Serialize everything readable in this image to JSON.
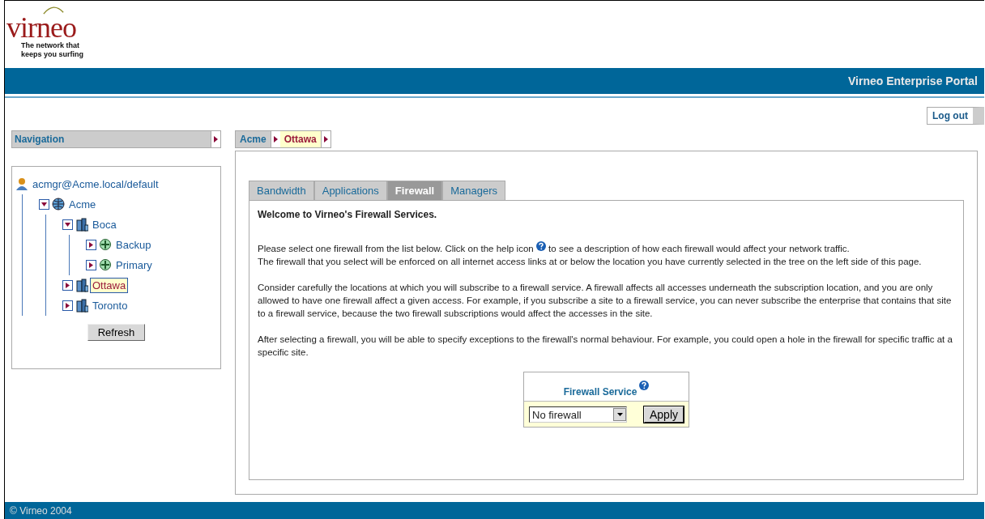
{
  "logo": {
    "wordmark": "virneo",
    "tagline": "The network that keeps you surfing"
  },
  "header_bar": {
    "title": "Virneo Enterprise Portal"
  },
  "logout_button": "Log out",
  "navigation": {
    "title": "Navigation",
    "tree": [
      {
        "label": "acmgr@Acme.local/default",
        "kind": "user",
        "selected": false,
        "children": [
          {
            "label": "Acme",
            "kind": "enterprise",
            "expanded": true,
            "selected": false,
            "children": [
              {
                "label": "Boca",
                "kind": "site",
                "expanded": true,
                "selected": false,
                "children": [
                  {
                    "label": "Backup",
                    "kind": "access",
                    "expanded": false,
                    "selected": false
                  },
                  {
                    "label": "Primary",
                    "kind": "access",
                    "expanded": false,
                    "selected": false
                  }
                ]
              },
              {
                "label": "Ottawa",
                "kind": "site",
                "expanded": false,
                "selected": true
              },
              {
                "label": "Toronto",
                "kind": "site",
                "expanded": false,
                "selected": false
              }
            ]
          }
        ]
      }
    ],
    "refresh_button": "Refresh"
  },
  "breadcrumb": [
    {
      "label": "Acme",
      "selected": false
    },
    {
      "label": "Ottawa",
      "selected": true
    }
  ],
  "tabs": [
    {
      "label": "Bandwidth",
      "selected": false
    },
    {
      "label": "Applications",
      "selected": false
    },
    {
      "label": "Firewall",
      "selected": true
    },
    {
      "label": "Managers",
      "selected": false
    }
  ],
  "content": {
    "heading": "Welcome to Virneo's Firewall Services.",
    "intro_before_icon": "Please select one firewall from the list below. Click on the help icon",
    "intro_after_icon": "to see a description of how each firewall would affect your network traffic.",
    "intro_rest": "The firewall that you select will be enforced on all internet access links at or below the location you have currently selected in the tree on the left side of this page.",
    "paragraphs": [
      "Consider carefully the locations at which you will subscribe to a firewall service. A firewall affects all accesses underneath the subscription location, and you are only allowed to have one firewall affect a given access. For example, if you subscribe a site to a firewall service, you can never subscribe the enterprise that contains that site to a firewall service, because the two firewall subscriptions would affect the accesses in the site.",
      "After selecting a firewall, you will be able to specify exceptions to the firewall's normal behaviour. For example, you could open a hole in the firewall for specific traffic at a specific site."
    ],
    "firewall_service": {
      "title": "Firewall Service",
      "value": "No firewall",
      "apply_button": "Apply"
    }
  },
  "footer": "© Virneo 2004"
}
